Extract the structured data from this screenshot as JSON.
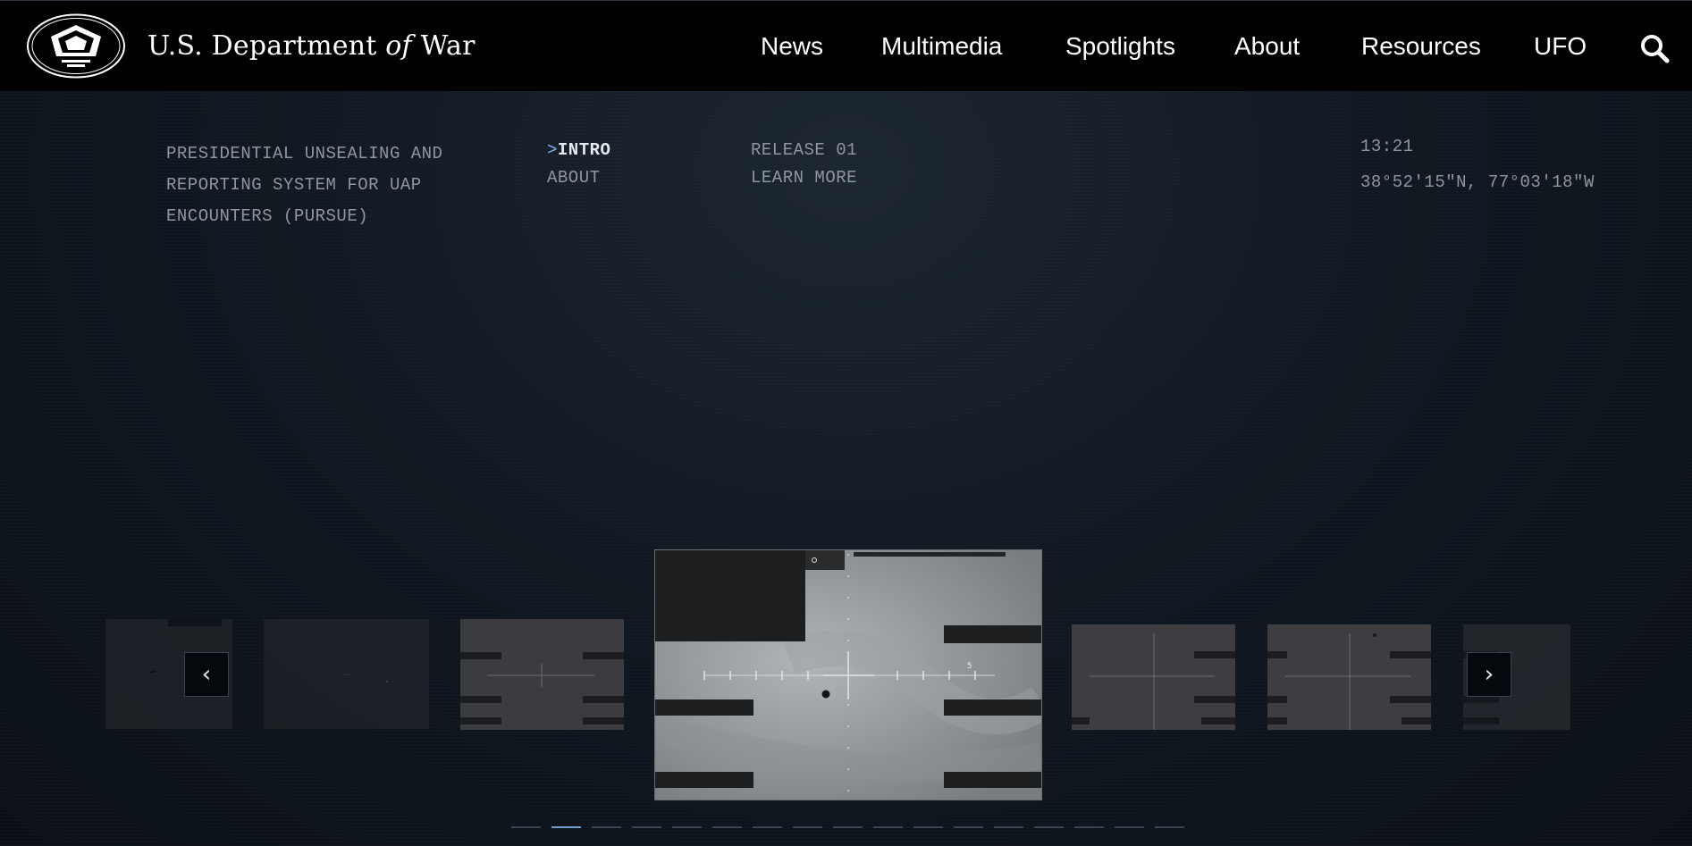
{
  "header": {
    "brand_prefix": "U.S. Department",
    "brand_of": "of",
    "brand_suffix": "War",
    "nav": [
      "News",
      "Multimedia",
      "Spotlights",
      "About",
      "Resources",
      "UFO"
    ]
  },
  "info": {
    "intro_lines": [
      "PRESIDENTIAL UNSEALING AND",
      "REPORTING SYSTEM FOR UAP",
      "ENCOUNTERS (PURSUE)"
    ],
    "menu_caret": ">",
    "menu_active": "INTRO",
    "menu_second": "ABOUT",
    "release_label": "RELEASE 01",
    "learn_more": "LEARN MORE",
    "time": "13:21",
    "coords": "38°52′15″N, 77°03′18″W"
  },
  "carousel": {
    "prev_arrow": "‹",
    "next_arrow": "›",
    "frame_marker": "5",
    "active_index": 1,
    "total_slides": 17
  },
  "colors": {
    "accent": "#6f9fd2",
    "muted_text": "#8f96a0"
  }
}
